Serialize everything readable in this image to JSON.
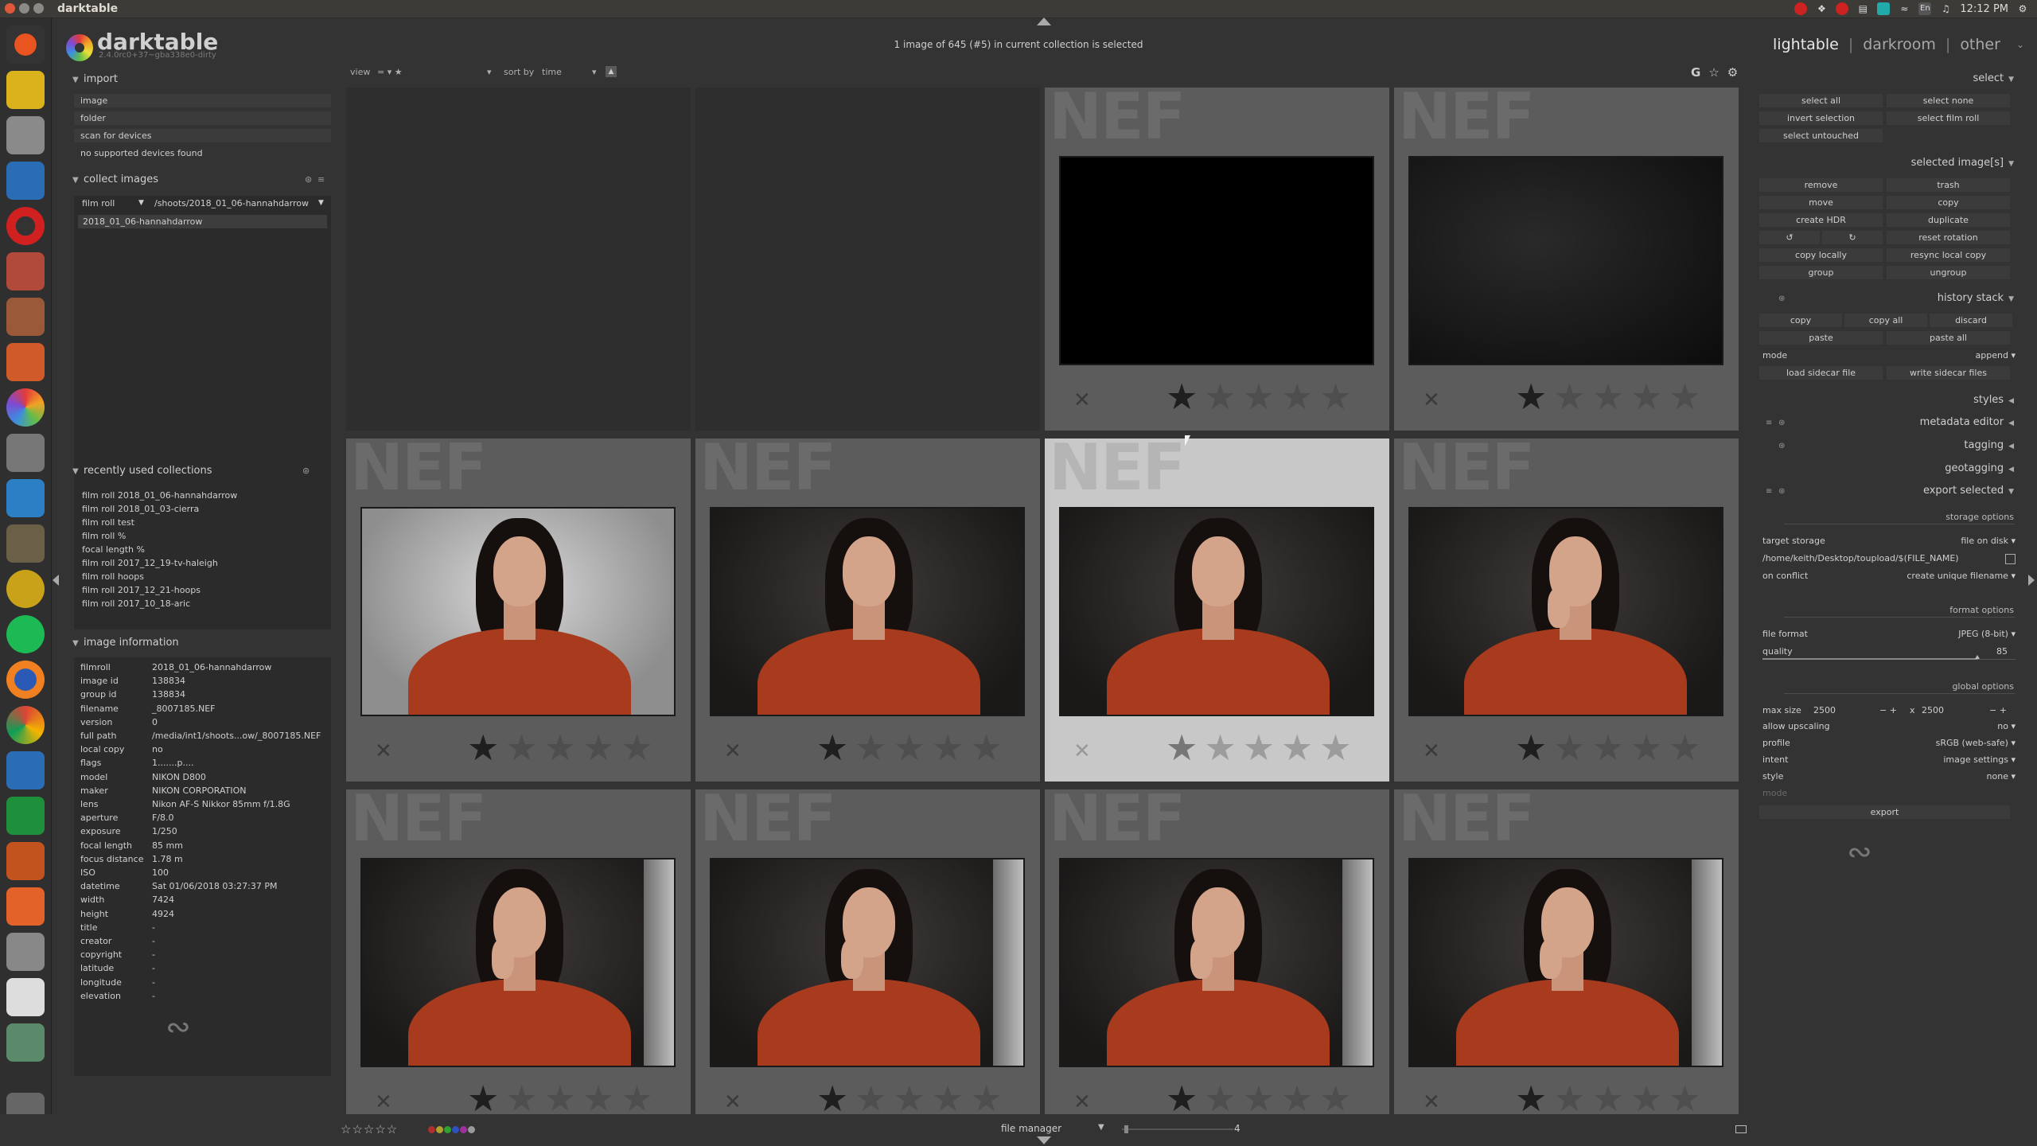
{
  "window": {
    "title": "darktable",
    "clock": "12:12 PM",
    "keyboard_layout": "En"
  },
  "app": {
    "name": "darktable",
    "version": "2.4.0rc0+37~gba338e0-dirty",
    "collection_status": "1 image of 645 (#5) in current collection is selected",
    "views": {
      "lighttable": "lightable",
      "darkroom": "darkroom",
      "other": "other"
    }
  },
  "toolbar": {
    "view_label": "view",
    "view_value": "= ▾ ★",
    "sort_label": "sort by",
    "sort_value": "time",
    "icons": [
      "grouping-icon",
      "star-overlay-icon",
      "gear-icon"
    ],
    "g_label": "G"
  },
  "left": {
    "import": {
      "header": "import",
      "items": [
        "image",
        "folder",
        "scan for devices",
        "no supported devices found"
      ]
    },
    "collect": {
      "header": "collect images",
      "property": "film roll",
      "path": "/shoots/2018_01_06-hannahdarrow",
      "selected": "2018_01_06-hannahdarrow"
    },
    "recent": {
      "header": "recently used collections",
      "items": [
        "film roll 2018_01_06-hannahdarrow",
        "film roll 2018_01_03-cierra",
        "film roll test",
        "film roll %",
        "focal length %",
        "film roll 2017_12_19-tv-haleigh",
        "film roll hoops",
        "film roll 2017_12_21-hoops",
        "film roll 2017_10_18-aric"
      ]
    },
    "info": {
      "header": "image information",
      "rows": [
        {
          "k": "filmroll",
          "v": "2018_01_06-hannahdarrow"
        },
        {
          "k": "image id",
          "v": "138834"
        },
        {
          "k": "group id",
          "v": "138834"
        },
        {
          "k": "filename",
          "v": "_8007185.NEF"
        },
        {
          "k": "version",
          "v": "0"
        },
        {
          "k": "full path",
          "v": "/media/int1/shoots...ow/_8007185.NEF"
        },
        {
          "k": "local copy",
          "v": "no"
        },
        {
          "k": "flags",
          "v": "1.......p...."
        },
        {
          "k": "model",
          "v": "NIKON D800"
        },
        {
          "k": "maker",
          "v": "NIKON CORPORATION"
        },
        {
          "k": "lens",
          "v": "Nikon AF-S Nikkor 85mm f/1.8G"
        },
        {
          "k": "aperture",
          "v": "F/8.0"
        },
        {
          "k": "exposure",
          "v": "1/250"
        },
        {
          "k": "focal length",
          "v": "85 mm"
        },
        {
          "k": "focus distance",
          "v": "1.78 m"
        },
        {
          "k": "ISO",
          "v": "100"
        },
        {
          "k": "datetime",
          "v": "Sat 01/06/2018 03:27:37 PM"
        },
        {
          "k": "width",
          "v": "7424"
        },
        {
          "k": "height",
          "v": "4924"
        },
        {
          "k": "title",
          "v": "-"
        },
        {
          "k": "creator",
          "v": "-"
        },
        {
          "k": "copyright",
          "v": "-"
        },
        {
          "k": "latitude",
          "v": "-"
        },
        {
          "k": "longitude",
          "v": "-"
        },
        {
          "k": "elevation",
          "v": "-"
        }
      ]
    }
  },
  "grid": {
    "watermark": "NEF",
    "reject_glyph": "✕",
    "star_glyph": "★"
  },
  "right": {
    "select": {
      "header": "select",
      "buttons": [
        "select all",
        "select none",
        "invert selection",
        "select film roll",
        "select untouched"
      ]
    },
    "selected": {
      "header": "selected image[s]",
      "buttons": [
        "remove",
        "trash",
        "move",
        "copy",
        "create HDR",
        "duplicate",
        "↺",
        "↻",
        "reset rotation",
        "copy locally",
        "resync local copy",
        "group",
        "ungroup"
      ]
    },
    "history": {
      "header": "history stack",
      "buttons": [
        "copy",
        "copy all",
        "discard",
        "paste",
        "paste all",
        "load sidecar file",
        "write sidecar files"
      ],
      "mode_label": "mode",
      "mode_value": "append"
    },
    "modules": [
      "styles",
      "metadata editor",
      "tagging",
      "geotagging",
      "export selected"
    ],
    "export": {
      "storage_header": "storage options",
      "target_storage_label": "target storage",
      "target_storage_value": "file on disk",
      "path": "/home/keith/Desktop/toupload/$(FILE_NAME)",
      "on_conflict_label": "on conflict",
      "on_conflict_value": "create unique filename",
      "format_header": "format options",
      "file_format_label": "file format",
      "file_format_value": "JPEG (8-bit)",
      "quality_label": "quality",
      "quality_value": "85",
      "global_header": "global options",
      "max_size_label": "max size",
      "max_w": "2500",
      "max_h": "2500",
      "x_label": "x",
      "upscaling_label": "allow upscaling",
      "upscaling_value": "no",
      "profile_label": "profile",
      "profile_value": "sRGB (web-safe)",
      "intent_label": "intent",
      "intent_value": "image settings",
      "style_label": "style",
      "style_value": "none",
      "mode_label": "mode",
      "export_button": "export"
    }
  },
  "bottom": {
    "stars": "☆☆☆☆☆",
    "color_labels": [
      "#b03030",
      "#b0a030",
      "#30a030",
      "#3050c0",
      "#a030a0",
      "#9a9a9a"
    ],
    "layout_label": "file manager",
    "zoom_value": "4"
  }
}
